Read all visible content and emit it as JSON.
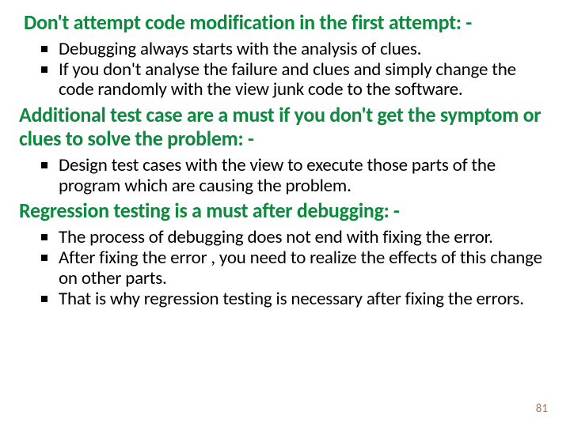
{
  "sections": [
    {
      "heading": "Don't attempt code modification in the first attempt: -",
      "heading_class": "first",
      "bullets": [
        "Debugging always starts with the analysis of clues.",
        "If you don't analyse the failure and clues and simply change the code randomly with the view junk code to the software."
      ]
    },
    {
      "heading": "Additional test case are a must if you don't get the symptom or clues to solve the problem: -",
      "heading_class": "mid1",
      "bullets": [
        "Design test cases with the view to execute those parts of the program which are causing the problem."
      ]
    },
    {
      "heading": "Regression testing is a must after debugging: -",
      "heading_class": "mid2",
      "bullets": [
        "The process of debugging does not end with fixing the error.",
        "After fixing the error , you need to realize the effects of this change on other parts.",
        "That is why regression testing is necessary after fixing the errors."
      ]
    }
  ],
  "page_number": "81"
}
